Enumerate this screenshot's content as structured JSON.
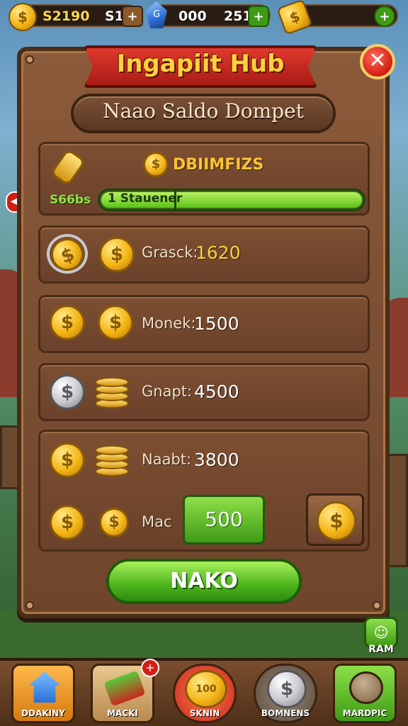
{
  "topbar": {
    "coins_value": "S2190",
    "coins_sub": "S1",
    "coins_plus": "+",
    "gems_icon_letter": "G",
    "gems_value": "000",
    "gems_sub": "251",
    "gems_plus": "+",
    "cash_plus": "+"
  },
  "panel": {
    "title": "Ingapiit Hub",
    "subtitle": "Naao Saldo Dompet",
    "close_label": "✕"
  },
  "progress_card": {
    "header": "DBIIMFIZS",
    "left_label": "S66bs",
    "bar_text": "1 Stauener",
    "fill_percent": 28
  },
  "rows": [
    {
      "label": "Grasck:",
      "value": "1620"
    },
    {
      "label": "Monek:",
      "value": "1500"
    },
    {
      "label": "Gnapt:",
      "value": "4500"
    },
    {
      "label": "Naabt:",
      "value": "3800"
    },
    {
      "label": "Mac",
      "value": "500"
    }
  ],
  "main_button": {
    "label": "NAKO"
  },
  "side_widget": {
    "label": "RAM"
  },
  "nav": [
    {
      "label": "DDAKINY"
    },
    {
      "label": "MACKI"
    },
    {
      "label": "SKNIN",
      "coin_text": "100"
    },
    {
      "label": "BOMNENS"
    },
    {
      "label": "MARDPIC"
    }
  ],
  "colors": {
    "title_gold": "#ffd23a",
    "ribbon_red": "#d21e14",
    "panel_brown": "#6e452b",
    "button_green": "#4cb41c"
  }
}
